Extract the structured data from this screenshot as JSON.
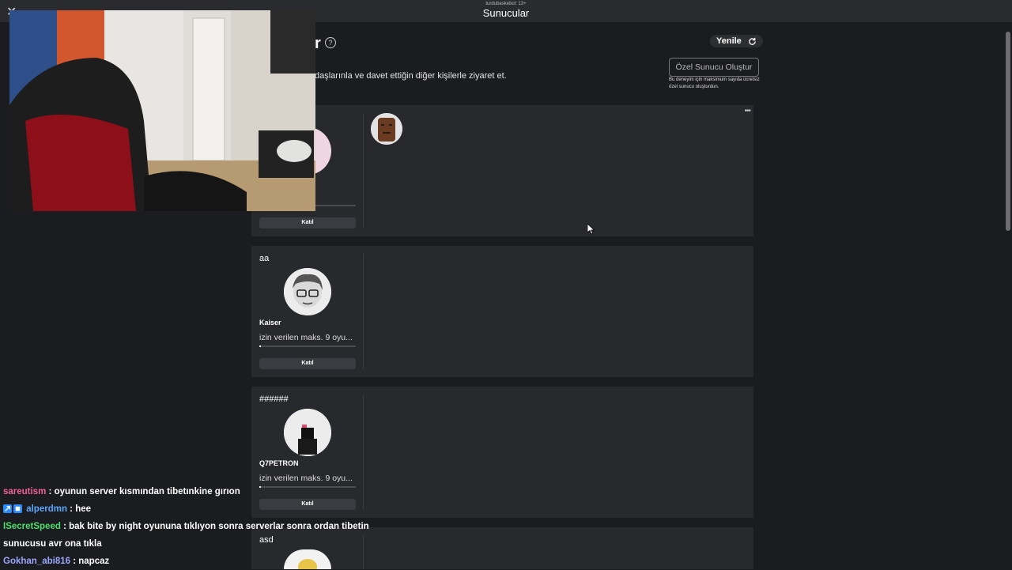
{
  "topbar": {
    "subtitle": "turdubaskebol: 13+",
    "title": "Sunucular"
  },
  "header": {
    "heading_fragment": "r",
    "description_fragment": "daşlarınla ve davet ettiğin diğer kişilerle ziyaret et.",
    "refresh_label": "Yenile",
    "private_server_button": "Özel Sunucu Oluştur",
    "private_server_note": "Bu deneyim için maksimum sayıda ücretsiz özel sunucu oluşturdun."
  },
  "servers": [
    {
      "name": "",
      "owner": "",
      "capacity": "ks. 9 oyu...",
      "join_label": "Katıl",
      "fill_fraction": 0.02
    },
    {
      "name": "aa",
      "owner": "Kaiser",
      "capacity": "izin verilen maks. 9 oyu...",
      "join_label": "Katıl",
      "fill_fraction": 0.02
    },
    {
      "name": "######",
      "owner": "Q7PETRON",
      "capacity": "izin verilen maks. 9 oyu...",
      "join_label": "Katıl",
      "fill_fraction": 0.02
    },
    {
      "name": "asd",
      "owner": "",
      "capacity": "",
      "join_label": "",
      "fill_fraction": 0.0
    }
  ],
  "chat": [
    {
      "user": "sareutism",
      "message": ": oyunun server kısmından tibetınkine gırıon"
    },
    {
      "user": "alperdmn",
      "message": ": hee"
    },
    {
      "user": "ISecretSpeed",
      "message": ": bak bite by night oyununa tıklıyon sonra serverlar sonra ordan tibetin sunucusu avr ona tıkla"
    },
    {
      "user": "Gokhan_abi816",
      "message": ": napcaz"
    }
  ],
  "colors": {
    "background": "#1b1c1f",
    "card": "#28292d",
    "chat_user_1": "#f0609a",
    "chat_user_2": "#5aa7ff",
    "chat_user_3": "#4ce06a",
    "chat_user_4": "#9aa7ff"
  }
}
